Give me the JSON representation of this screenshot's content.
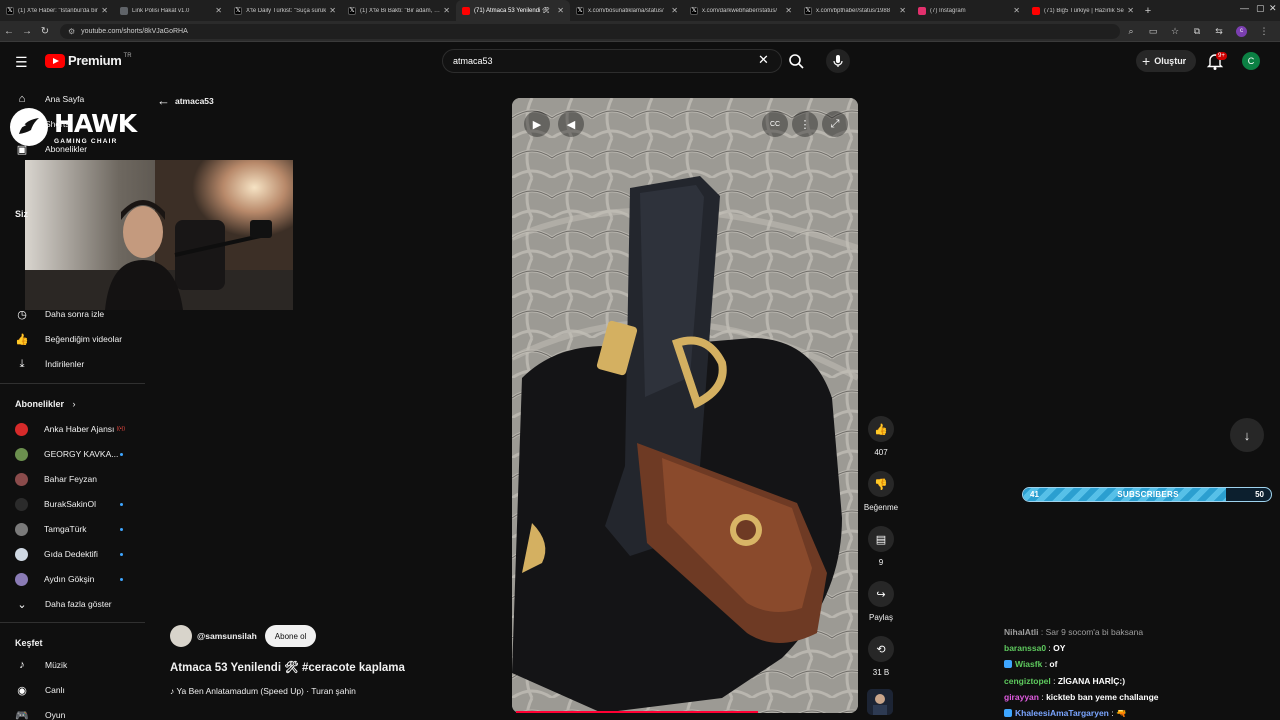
{
  "browser": {
    "tabs": [
      {
        "title": "(1) X'te Haber: \"İstanbul'da bir",
        "favicon": "x-icon",
        "fav_color": "#000000",
        "active": false
      },
      {
        "title": "Link Polisi Hakat v1.0",
        "favicon": "page-icon",
        "fav_color": "#5f6368",
        "active": false
      },
      {
        "title": "X'te Daily Türkist: \"Suça sürük",
        "favicon": "x-icon",
        "fav_color": "#000000",
        "active": false
      },
      {
        "title": "(1) X'te Bi Bakti: \"Bir adam, 2 y",
        "favicon": "x-icon",
        "fav_color": "#000000",
        "active": false
      },
      {
        "title": "(71) Atmaca 53 Yenilendi 🛠",
        "favicon": "youtube-icon",
        "fav_color": "#ff0000",
        "active": true
      },
      {
        "title": "x.com/bosunatiklama/status/",
        "favicon": "x-icon",
        "fav_color": "#000000",
        "active": false
      },
      {
        "title": "x.com/darkwebhaber/status/",
        "favicon": "x-icon",
        "fav_color": "#000000",
        "active": false
      },
      {
        "title": "x.com/bpthaber/status/1988",
        "favicon": "x-icon",
        "fav_color": "#000000",
        "active": false
      },
      {
        "title": "(7) Instagram",
        "favicon": "instagram-icon",
        "fav_color": "#e1306c",
        "active": false
      },
      {
        "title": "(71) Big5 Türkiye | Hazırlık Se",
        "favicon": "youtube-icon",
        "fav_color": "#ff0000",
        "active": false
      }
    ],
    "url": "youtube.com/shorts/8kVJaGoRHA",
    "profile_initial": "c"
  },
  "header": {
    "logo_text": "Premium",
    "logo_region": "TR",
    "search_value": "atmaca53",
    "create_label": "Oluştur",
    "notif_badge": "9+",
    "avatar_initial": "C"
  },
  "sidebar": {
    "top_items": [
      {
        "label": "Ana Sayfa",
        "icon": "home-icon",
        "glyph": "⌂"
      },
      {
        "label": "Shorts",
        "icon": "shorts-icon",
        "glyph": "▶"
      },
      {
        "label": "Abonelikler",
        "icon": "subscriptions-icon",
        "glyph": "▣"
      }
    ],
    "you_section": "Siz",
    "you_items": [
      {
        "label": "Daha sonra izle",
        "icon": "clock-icon",
        "glyph": "◷"
      },
      {
        "label": "Beğendiğim videolar",
        "icon": "thumbs-up-icon",
        "glyph": "👍"
      },
      {
        "label": "İndirilenler",
        "icon": "download-icon",
        "glyph": "⤓"
      }
    ],
    "subs_title": "Abonelikler",
    "channels": [
      {
        "name": "Anka Haber Ajansı",
        "color": "#d62a2a",
        "status": "live"
      },
      {
        "name": "GEORGY KAVKA...",
        "color": "#6b8f4e",
        "status": "new"
      },
      {
        "name": "Bahar Feyzan",
        "color": "#8a4b4b",
        "status": "none"
      },
      {
        "name": "BurakSakinOl",
        "color": "#2b2b2b",
        "status": "new"
      },
      {
        "name": "TamgaTürk",
        "color": "#7a7a7a",
        "status": "new"
      },
      {
        "name": "Gıda Dedektifi",
        "color": "#cfd8e3",
        "status": "new"
      },
      {
        "name": "Aydın Gökşin",
        "color": "#8a7bb5",
        "status": "new"
      }
    ],
    "show_more": "Daha fazla göster",
    "explore_title": "Keşfet",
    "explore_items": [
      {
        "label": "Müzik",
        "icon": "music-icon",
        "glyph": "♪"
      },
      {
        "label": "Canlı",
        "icon": "live-icon",
        "glyph": "◉"
      },
      {
        "label": "Oyun",
        "icon": "gaming-icon",
        "glyph": "🎮"
      }
    ]
  },
  "overlay": {
    "brand": "HAWK",
    "brand_sub": "GAMING CHAIR"
  },
  "shorts": {
    "back_label": "atmaca53",
    "likes": "407",
    "dislike_label": "Beğenme",
    "comments": "9",
    "share_label": "Paylaş",
    "remix_count": "31 B",
    "channel_handle": "@samsunsilah",
    "subscribe_label": "Abone ol",
    "title": "Atmaca 53 Yenilendi 🛠 #ceracote kaplama",
    "music": "Ya Ben Anlatamadum (Speed Up) · Turan şahin",
    "progress": 0.7
  },
  "subscriber_goal": {
    "current": "41",
    "label": "SUBSCRIBERS",
    "goal": "50",
    "fill": 0.82
  },
  "chat": [
    {
      "user": "NihalAtli",
      "text": "Sar 9 socom'a bi baksana",
      "color": "#9e9e9e",
      "text_color": "#9e9e9e",
      "badge": false
    },
    {
      "user": "baranssa0",
      "text": "OY",
      "color": "#5ec95e",
      "text_color": "#ffffff",
      "badge": false
    },
    {
      "user": "Wiasfk",
      "text": "of",
      "color": "#5ec95e",
      "text_color": "#ffffff",
      "badge": true
    },
    {
      "user": "cengiztopel",
      "text": "ZİGANA HARİÇ:)",
      "color": "#5ec95e",
      "text_color": "#ffffff",
      "badge": false
    },
    {
      "user": "girayyan",
      "text": "kickteb ban yeme challange",
      "color": "#e05ce0",
      "text_color": "#ffffff",
      "badge": false
    },
    {
      "user": "KhaleesiAmaTargaryen",
      "text": "🔫",
      "color": "#7aa5ff",
      "text_color": "#ffffff",
      "badge": true
    }
  ]
}
